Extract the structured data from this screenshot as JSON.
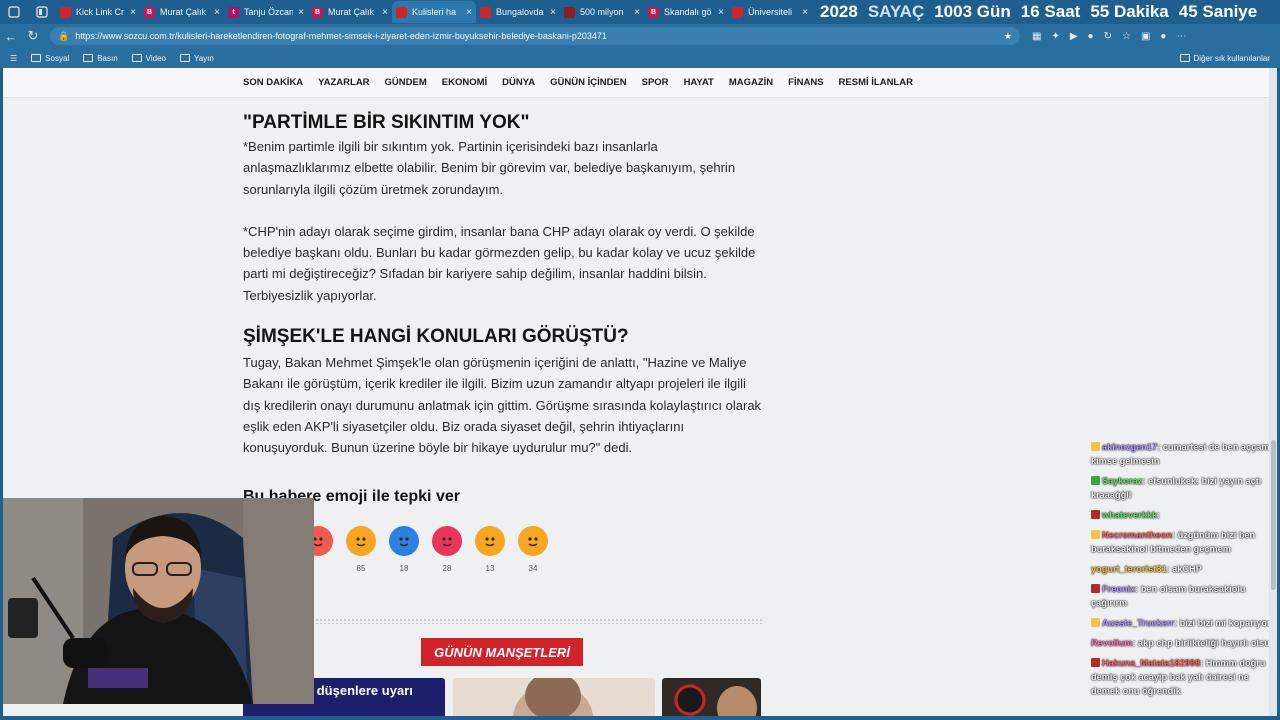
{
  "tabs": [
    {
      "title": "Kick Link Cr",
      "fav_color": "#d0232a",
      "fav_letter": ""
    },
    {
      "title": "Murat Çalık",
      "fav_color": "#c2185b",
      "fav_letter": "B"
    },
    {
      "title": "Tanju Özcan",
      "fav_color": "#b0126a",
      "fav_letter": "t"
    },
    {
      "title": "Murat Çalık",
      "fav_color": "#c2185b",
      "fav_letter": "B"
    },
    {
      "title": "Kulisleri ha",
      "fav_color": "#d0232a",
      "fav_letter": ""
    },
    {
      "title": "Bungalovda",
      "fav_color": "#d0232a",
      "fav_letter": ""
    },
    {
      "title": "500 milyon",
      "fav_color": "#8e1d1d",
      "fav_letter": ""
    },
    {
      "title": "Skandalı gö",
      "fav_color": "#c2185b",
      "fav_letter": "B"
    },
    {
      "title": "Üniversiteli",
      "fav_color": "#d0232a",
      "fav_letter": ""
    }
  ],
  "counter": {
    "year": "2028",
    "label": "SAYAÇ",
    "days": "1003 Gün",
    "hours": "16 Saat",
    "minutes": "55 Dakika",
    "seconds": "45 Saniye"
  },
  "address": {
    "url": "https://www.sozcu.com.tr/kulisleri-hareketlendiren-fotograf-mehmet-simsek-i-ziyaret-eden-izmir-buyuksehir-belediye-baskani-p203471"
  },
  "bookmarks": {
    "items": [
      "Sosyal",
      "Basın",
      "Video",
      "Yayın"
    ],
    "other": "Diğer sık kullanılanlar"
  },
  "site_nav": [
    "SON DAKİKA",
    "YAZARLAR",
    "GÜNDEM",
    "EKONOMİ",
    "DÜNYA",
    "GÜNÜN İÇİNDEN",
    "SPOR",
    "HAYAT",
    "MAGAZİN",
    "FİNANS",
    "RESMİ İLANLAR"
  ],
  "article": {
    "heading1": "\"PARTİMLE BİR SIKINTIM YOK\"",
    "para1": "*Benim partimle ilgili bir sıkıntım yok. Partinin içerisindeki bazı insanlarla anlaşmazlıklarımız elbette olabilir.  Benim bir görevim var, belediye başkanıyım, şehrin sorunlarıyla ilgili çözüm üretmek zorundayım.",
    "para2": "*CHP'nin adayı olarak seçime girdim, insanlar bana CHP adayı olarak oy verdi. O şekilde belediye başkanı oldu. Bunları bu kadar görmezden gelip, bu kadar kolay ve ucuz şekilde parti mi değiştireceğiz? Sıfadan bir kariyere sahip değilim, insanlar haddini bilsin. Terbiyesizlik yapıyorlar.",
    "heading2": "ŞİMŞEK'LE HANGİ KONULARI GÖRÜŞTÜ?",
    "para3": "Tugay, Bakan Mehmet Şimşek'le olan görüşmenin içeriğini de anlattı, \"Hazine ve Maliye Bakanı ile görüştüm, içerik krediler ile ilgili. Bizim uzun zamandır altyapı projeleri ile ilgili dış kredilerin onayı durumunu anlatmak için gittim. Görüşme sırasında kolaylaştırıcı olarak eşlik eden AKP'li siyasetçiler oldu. Biz orada siyaset değil, şehrin ihtiyaçlarını konuşuyorduk. Bunun üzerine böyle bir hikaye uydurulur mu?\" dedi."
  },
  "reactions": {
    "title": "Bu habere emoji ile tepki ver",
    "items": [
      {
        "name": "love-emoji",
        "count": "",
        "color": "#f05a4f"
      },
      {
        "name": "laugh-emoji",
        "count": "85",
        "color": "#f6a623"
      },
      {
        "name": "like-emoji",
        "count": "18",
        "color": "#2d7fe0"
      },
      {
        "name": "heart-emoji",
        "count": "28",
        "color": "#e8355c"
      },
      {
        "name": "sad-emoji",
        "count": "13",
        "color": "#f6a623"
      },
      {
        "name": "wow-emoji",
        "count": "34",
        "color": "#f6a623"
      }
    ]
  },
  "headlines": {
    "title": "GÜNÜN MANŞETLERİ",
    "thumb1_caption": "Bu hataya düşenlere uyarı"
  },
  "chat": [
    {
      "user": "akinozgen17",
      "user_color": "#b197fc",
      "text": "cumartesi de ben aççam kimse gelmesin",
      "badge": "#f6c343"
    },
    {
      "user": "Saykoraz",
      "user_color": "#63e06b",
      "text": "efsunlukek: bizi yayın açtı kraaağğll",
      "badge": "#3aa63f"
    },
    {
      "user": "whateverkkk",
      "user_color": "#63e06b",
      "text": "",
      "badge": "#b52a2a"
    },
    {
      "user": "Necromantheon",
      "user_color": "#ff5f5f",
      "text": "üzgünüm bizi ben buraksakinol bitmeden geçmem",
      "badge": "#f6c343"
    },
    {
      "user": "yogurt_terorist31",
      "user_color": "#f6c343",
      "text": "akCHP",
      "badge": ""
    },
    {
      "user": "Freonix",
      "user_color": "#b197fc",
      "text": "ben olsam buraksakiolu çağırırm",
      "badge": "#b52a2a"
    },
    {
      "user": "Aussie_Truckerr",
      "user_color": "#b197fc",
      "text": "bizi bizi mi koparıyor",
      "badge": "#f6c343"
    },
    {
      "user": "Revollum",
      "user_color": "#ff6fae",
      "text": "akp chp birlikteliği hayırlı olsun",
      "badge": ""
    },
    {
      "user": "Hakuna_Matata182998",
      "user_color": "#ff5f5f",
      "text": "Hmmm doğru demiş çok acayip bak yalı dairesi ne demek onu öğrendik",
      "badge": "#b52a2a"
    }
  ]
}
